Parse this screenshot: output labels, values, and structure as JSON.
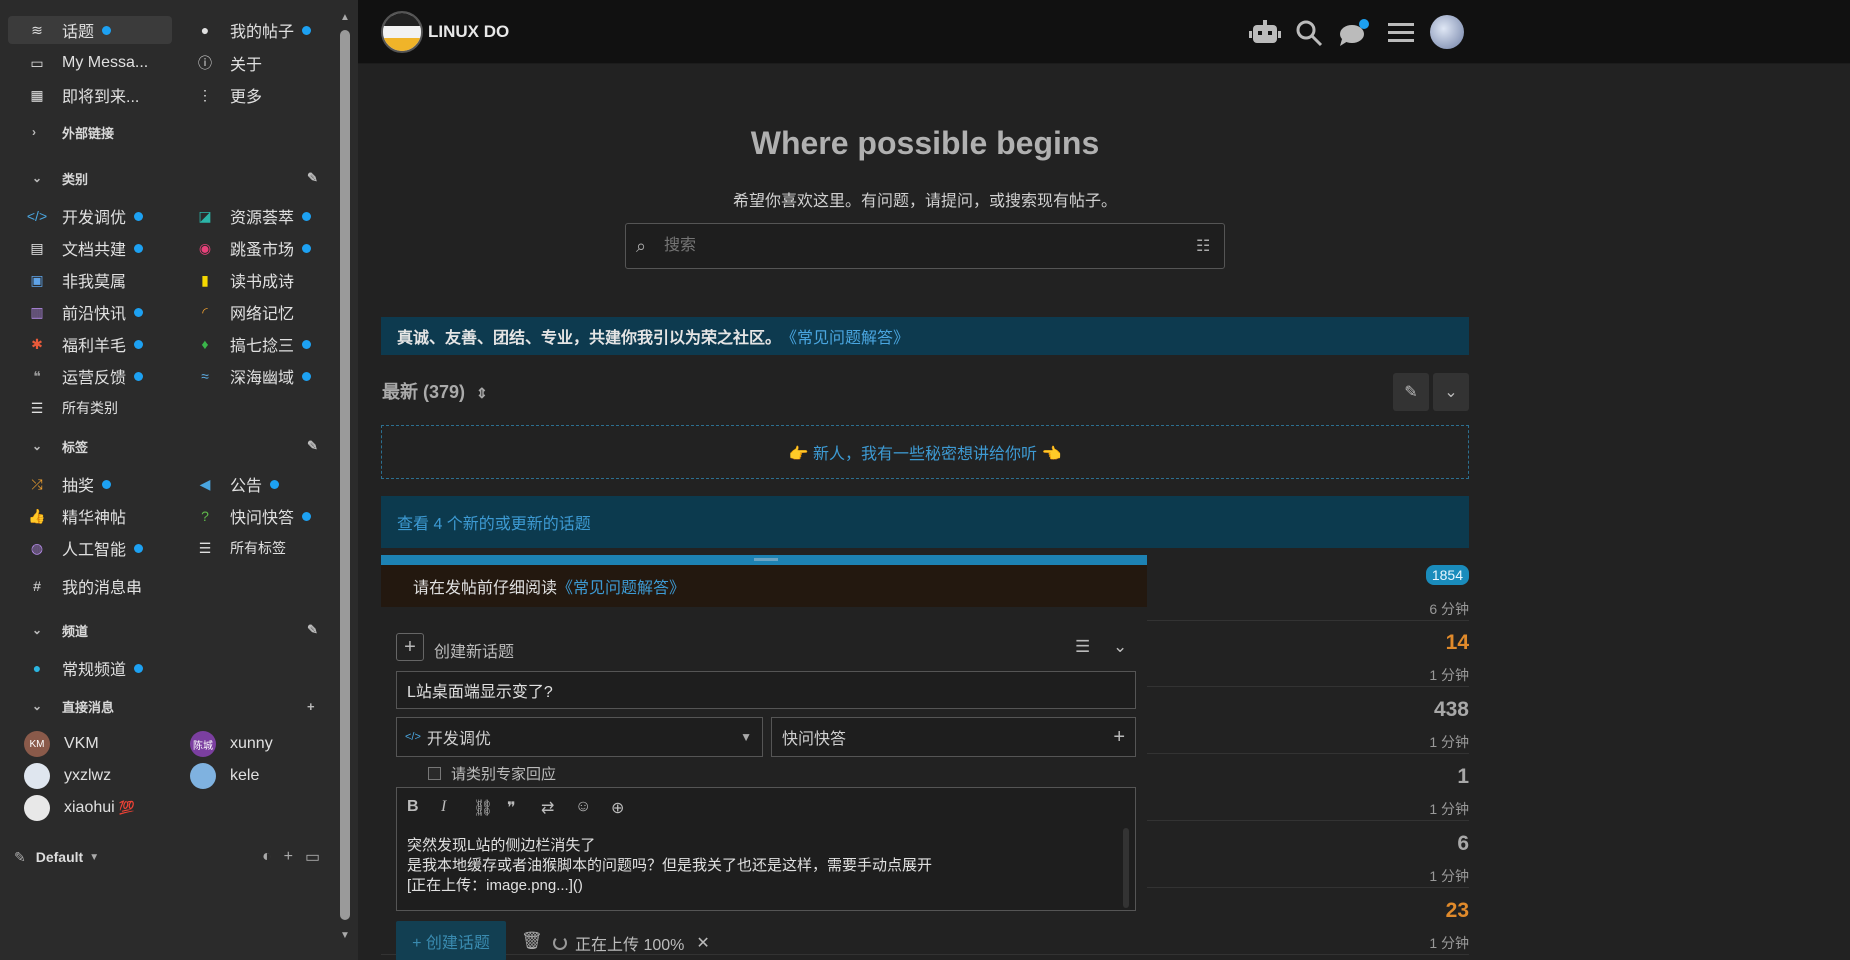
{
  "sidebar": {
    "nav": [
      {
        "label": "话题",
        "icon": "layers-icon",
        "dot": true
      },
      {
        "label": "我的帖子",
        "icon": "user-icon",
        "dot": true
      },
      {
        "label": "My Messa...",
        "icon": "inbox-icon",
        "dot": false
      },
      {
        "label": "关于",
        "icon": "info-icon",
        "dot": false
      },
      {
        "label": "即将到来...",
        "icon": "calendar-icon",
        "dot": false
      },
      {
        "label": "更多",
        "icon": "more-vertical-icon",
        "dot": false
      }
    ],
    "external_links_label": "外部链接",
    "categories_label": "类别",
    "categories": [
      {
        "label": "开发调优",
        "icon": "code-icon",
        "color": "#4aa6e0",
        "dot": true
      },
      {
        "label": "资源荟萃",
        "icon": "share-icon",
        "color": "#2bb5a8",
        "dot": true
      },
      {
        "label": "文档共建",
        "icon": "book-icon",
        "color": "#e8e8e8",
        "dot": true
      },
      {
        "label": "跳蚤市场",
        "icon": "coins-icon",
        "color": "#e8417a",
        "dot": true
      },
      {
        "label": "非我莫属",
        "icon": "briefcase-icon",
        "color": "#5fa3e8",
        "dot": false
      },
      {
        "label": "读书成诗",
        "icon": "books-icon",
        "color": "#f5d800",
        "dot": false
      },
      {
        "label": "前沿快讯",
        "icon": "newspaper-icon",
        "color": "#b58be8",
        "dot": true
      },
      {
        "label": "网络记忆",
        "icon": "rss-icon",
        "color": "#f0a030",
        "dot": false
      },
      {
        "label": "福利羊毛",
        "icon": "sheep-icon",
        "color": "#e85a3a",
        "dot": true
      },
      {
        "label": "搞七捻三",
        "icon": "leaf-icon",
        "color": "#3ab54a",
        "dot": true
      },
      {
        "label": "运营反馈",
        "icon": "comments-icon",
        "color": "#9a9a9a",
        "dot": true
      },
      {
        "label": "深海幽域",
        "icon": "water-icon",
        "color": "#5fb0e8",
        "dot": true
      }
    ],
    "all_categories_label": "所有类别",
    "tags_label": "标签",
    "tags": [
      {
        "label": "抽奖",
        "icon": "shuffle-icon",
        "color": "#f0a030",
        "dot": true
      },
      {
        "label": "公告",
        "icon": "megaphone-icon",
        "color": "#4aa6e0",
        "dot": true
      },
      {
        "label": "精华神帖",
        "icon": "thumbs-up-icon",
        "color": "#4aa6e0",
        "dot": false
      },
      {
        "label": "快问快答",
        "icon": "question-icon",
        "color": "#5fb84a",
        "dot": true
      },
      {
        "label": "人工智能",
        "icon": "brain-icon",
        "color": "#b58be8",
        "dot": true
      }
    ],
    "all_tags_label": "所有标签",
    "my_threads_label": "我的消息串",
    "channels_label": "频道",
    "channels": [
      {
        "label": "常规频道",
        "dot": true
      }
    ],
    "dm_label": "直接消息",
    "dms": [
      {
        "name": "VKM",
        "initials": "KM",
        "color": "#8a5a4a"
      },
      {
        "name": "xunny",
        "initials": "陈城",
        "color": "#7b3fa0"
      },
      {
        "name": "yxzlwz",
        "initials": "",
        "color": "#dfe6ef"
      },
      {
        "name": "kele",
        "initials": "",
        "color": "#7fb2e0"
      },
      {
        "name": "xiaohui",
        "initials": "",
        "color": "#e8e8e8",
        "emoji": "💯"
      }
    ],
    "theme_label": "Default"
  },
  "header": {
    "site_title": "LINUX DO"
  },
  "hero": {
    "title": "Where possible begins",
    "subtitle": "希望你喜欢这里。有问题，请提问，或搜索现有帖子。",
    "search_placeholder": "搜索"
  },
  "banner": {
    "bold": "真诚、友善、团结、专业，共建你我引以为荣之社区。",
    "link": "《常见问题解答》"
  },
  "list": {
    "heading": "最新 (379)",
    "welcome": "👉 新人，我有一些秘密想讲给你听 👈",
    "new_topics": "查看 4 个新的或更新的话题",
    "rows": [
      {
        "replies": "1854",
        "ago": "6 分钟",
        "badge": true,
        "hot": false
      },
      {
        "replies": "14",
        "ago": "1 分钟",
        "badge": false,
        "hot": true
      },
      {
        "replies": "438",
        "ago": "1 分钟",
        "badge": false,
        "hot": false
      },
      {
        "replies": "1",
        "ago": "1 分钟",
        "badge": false,
        "hot": false
      },
      {
        "replies": "6",
        "ago": "1 分钟",
        "badge": false,
        "hot": false
      },
      {
        "replies": "23",
        "ago": "1 分钟",
        "badge": false,
        "hot": true
      }
    ]
  },
  "composer": {
    "warning_text": "请在发帖前仔细阅读",
    "warning_link": "《常见问题解答》",
    "action_label": "创建新话题",
    "title_value": "L站桌面端显示变了?",
    "category": "开发调优",
    "tag_placeholder": "快问快答",
    "expert_label": "请类别专家回应",
    "body_lines": [
      "突然发现L站的侧边栏消失了",
      "是我本地缓存或者油猴脚本的问题吗？但是我关了也还是这样，需要手动点展开",
      "[正在上传：image.png...]()"
    ],
    "submit_label": "+ 创建话题",
    "upload_status": "正在上传 100%"
  }
}
